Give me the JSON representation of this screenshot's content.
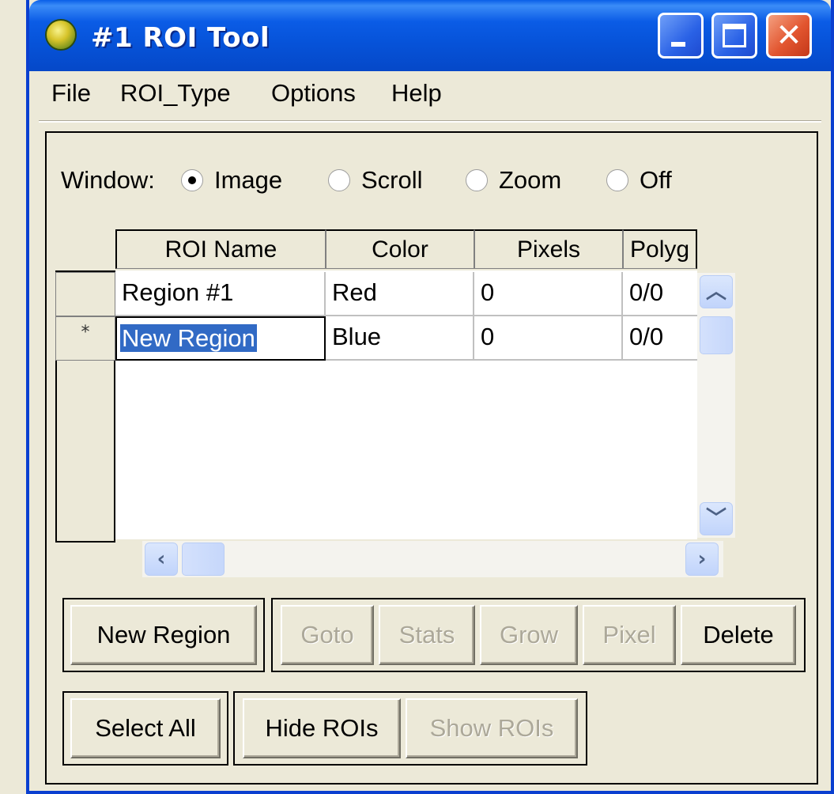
{
  "window": {
    "title": "#1 ROI Tool",
    "controls": {
      "minimize": "",
      "maximize": "",
      "close": "✕"
    }
  },
  "menu": [
    "File",
    "ROI_Type",
    "Options",
    "Help"
  ],
  "window_select": {
    "label": "Window:",
    "options": [
      "Image",
      "Scroll",
      "Zoom",
      "Off"
    ],
    "selected": "Image"
  },
  "table": {
    "columns": [
      "ROI Name",
      "Color",
      "Pixels",
      "Polyg"
    ],
    "rows": [
      {
        "marker": "",
        "name": "Region #1",
        "color": "Red",
        "pixels": "0",
        "polygons": "0/0"
      },
      {
        "marker": "*",
        "name": "New Region",
        "color": "Blue",
        "pixels": "0",
        "polygons": "0/0"
      }
    ]
  },
  "buttons": {
    "new_region": "New Region",
    "goto": "Goto",
    "stats": "Stats",
    "grow": "Grow",
    "pixel": "Pixel",
    "delete": "Delete",
    "select_all": "Select All",
    "hide_rois": "Hide ROIs",
    "show_rois": "Show ROIs"
  },
  "colors": {
    "titlebar": "#0653d9",
    "close_button": "#e2552f",
    "dialog_bg": "#ece9d8",
    "selection": "#316ac5",
    "disabled_text": "#aca899"
  }
}
